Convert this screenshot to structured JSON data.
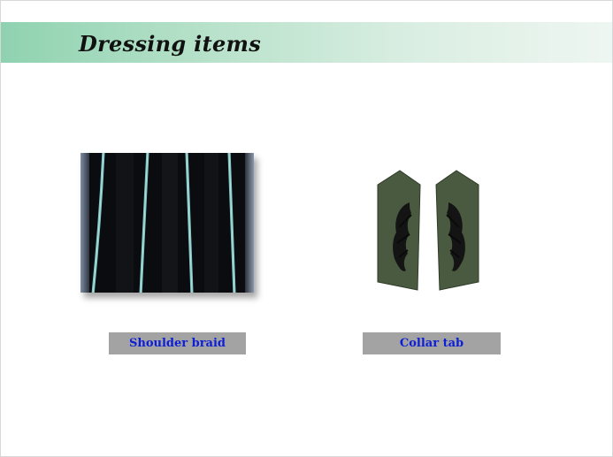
{
  "slide": {
    "title": "Dressing items"
  },
  "items": [
    {
      "caption": "Shoulder braid",
      "image_subject": "shoulder braid stripes"
    },
    {
      "caption": "Collar tab",
      "image_subject": "pair of embroidered collar tabs"
    }
  ],
  "colors": {
    "title_band_start": "#8fd2b0",
    "title_band_end": "#eef6f1",
    "caption_background": "#a3a3a3",
    "caption_text": "#0d1fd6",
    "braid_fabric": "#0b0c10",
    "braid_stripe": "#7fc6c2",
    "collar_tab_fabric": "#4a5a40",
    "collar_tab_embroidery": "#141414"
  }
}
